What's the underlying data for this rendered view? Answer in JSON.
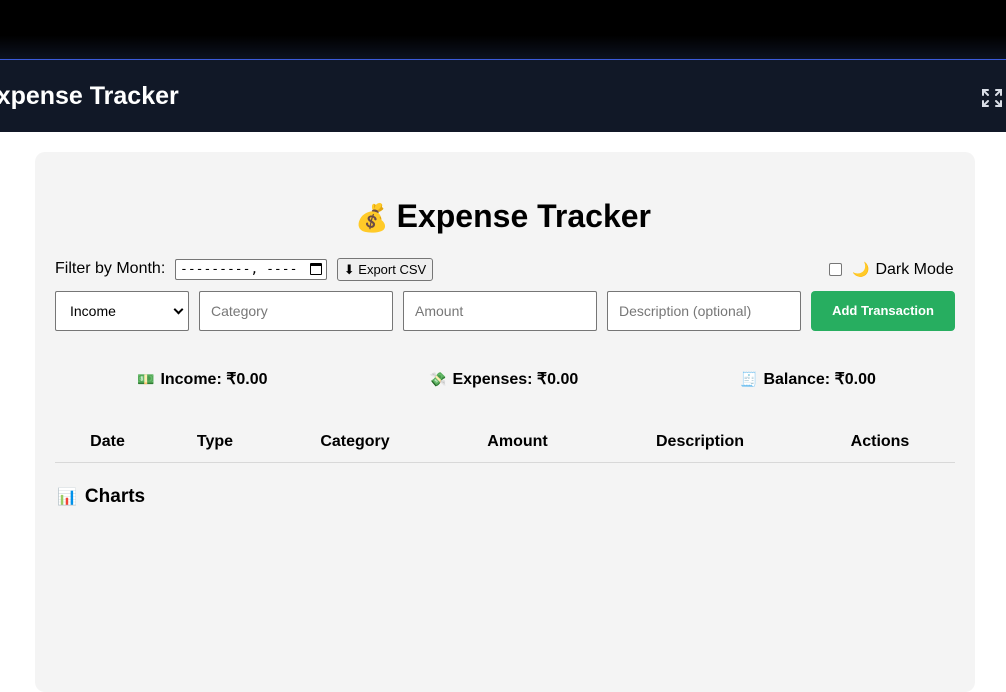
{
  "window": {
    "app_title": "Expense Tracker",
    "expand_icon": "expand-icon"
  },
  "page": {
    "title_emoji": "💰",
    "title": "Expense Tracker"
  },
  "filter": {
    "label": "Filter by Month:",
    "month_value": "---------, ----",
    "export_label": "⬇ Export CSV"
  },
  "dark_mode": {
    "emoji": "🌙",
    "label": "Dark Mode",
    "checked": false
  },
  "form": {
    "type_selected": "Income",
    "category_placeholder": "Category",
    "amount_placeholder": "Amount",
    "description_placeholder": "Description (optional)",
    "submit_label": "Add Transaction",
    "submit_color": "#27ae60"
  },
  "summary": {
    "income_emoji": "💵",
    "income": "Income: ₹0.00",
    "expenses_emoji": "💸",
    "expenses": "Expenses: ₹0.00",
    "balance_emoji": "🧾",
    "balance": "Balance: ₹0.00"
  },
  "table": {
    "headers": [
      "Date",
      "Type",
      "Category",
      "Amount",
      "Description",
      "Actions"
    ],
    "rows": []
  },
  "charts": {
    "emoji": "📊",
    "heading": "Charts"
  }
}
